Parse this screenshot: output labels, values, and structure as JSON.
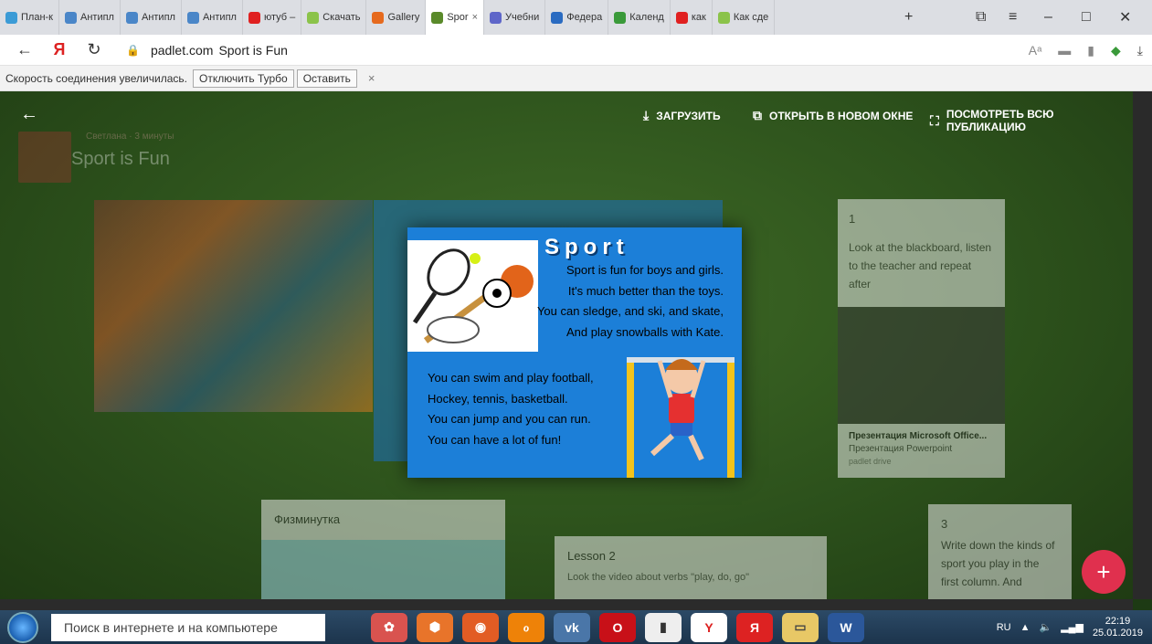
{
  "browser": {
    "tabs": [
      {
        "label": "План-к",
        "color": "#3b9bd6"
      },
      {
        "label": "Антипл",
        "color": "#4a86c8"
      },
      {
        "label": "Антипл",
        "color": "#4a86c8"
      },
      {
        "label": "Антипл",
        "color": "#4a86c8"
      },
      {
        "label": "ютуб –",
        "color": "#e02020"
      },
      {
        "label": "Скачать",
        "color": "#8bc34a"
      },
      {
        "label": "Gallery",
        "color": "#e66a1e"
      },
      {
        "label": "Spor",
        "color": "#5a8a2a",
        "active": true
      },
      {
        "label": "Учебни",
        "color": "#5e66c9"
      },
      {
        "label": "Федера",
        "color": "#2a6bc1"
      },
      {
        "label": "Календ",
        "color": "#3a9a3a"
      },
      {
        "label": "как",
        "color": "#e02020"
      },
      {
        "label": "Как сде",
        "color": "#8bc34a"
      }
    ],
    "new_tab_symbol": "+",
    "address": {
      "host": "padlet.com",
      "title": "Sport is Fun"
    },
    "turbo": {
      "message": "Скорость соединения увеличилась.",
      "disable_btn": "Отключить Турбо",
      "keep_btn": "Оставить",
      "close": "×"
    }
  },
  "padlet": {
    "toolbar": {
      "download": "ЗАГРУЗИТЬ",
      "open_new": "ОТКРЫТЬ В НОВОМ ОКНЕ",
      "view_all": "ПОСМОТРЕТЬ ВСЮ ПУБЛИКАЦИЮ"
    },
    "author": {
      "name": "Светлана",
      "time": "3 минуты"
    },
    "page_title": "Sport is Fun",
    "cards": {
      "card1_number": "1",
      "card1_text": "Look at the blackboard, listen to the teacher and repeat after",
      "ppt_title": "Презентация Microsoft Office...",
      "ppt_sub": "Презентация Powerpoint",
      "ppt_source": "padlet drive",
      "fizm": "Физминутка",
      "lesson2_title": "Lesson 2",
      "lesson2_text": "Look the video about verbs \"play, do, go\"",
      "card3_number": "3",
      "card3_text": "Write down the kinds of sport you play in the first column. And"
    },
    "fab": "+"
  },
  "modal": {
    "heading": "Sport",
    "verse_right": [
      "Sport is fun for boys and girls.",
      "It's much better than the toys.",
      "You can sledge, and ski, and skate,",
      "And play snowballs with Kate."
    ],
    "verse_left": [
      "You can swim and play football,",
      "Hockey, tennis, basketball.",
      "You can jump and you can run.",
      "You can have a lot of fun!"
    ]
  },
  "taskbar": {
    "search_placeholder": "Поиск в интернете и на компьютере",
    "lang": "RU",
    "time": "22:19",
    "date": "25.01.2019"
  }
}
